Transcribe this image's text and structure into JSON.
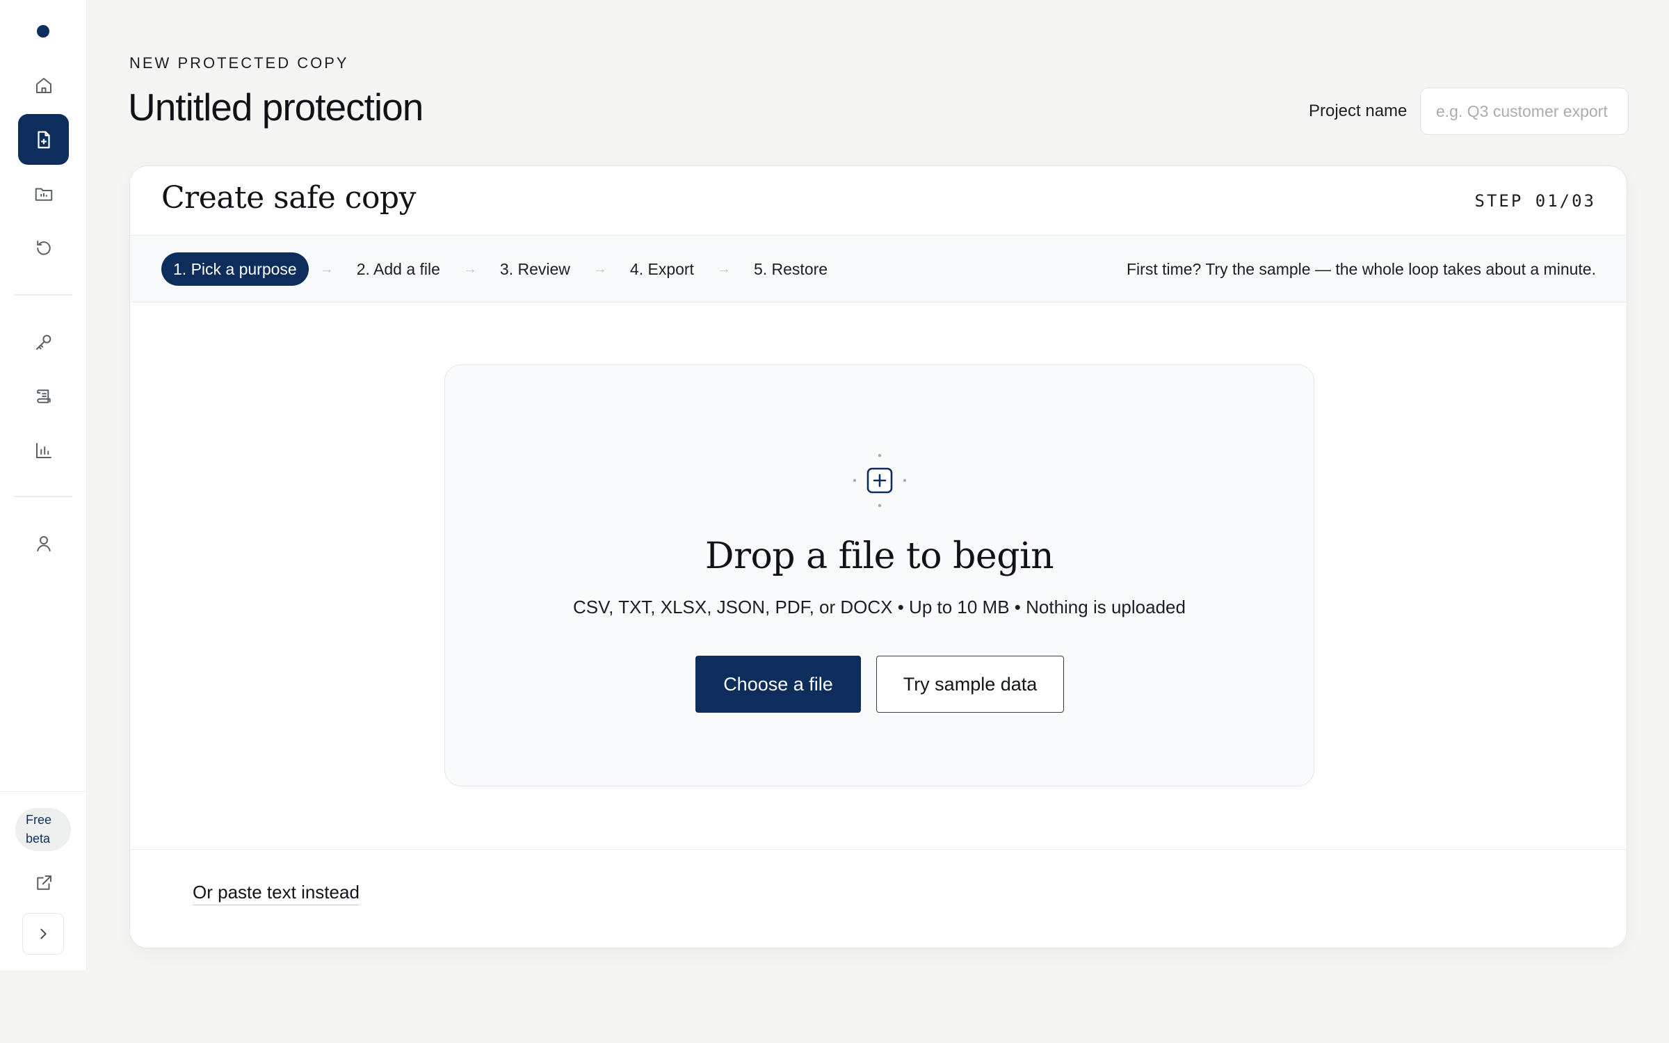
{
  "sidebar": {
    "nav": [
      {
        "name": "nav-home",
        "icon": "home-icon"
      },
      {
        "name": "nav-new-copy",
        "icon": "file-plus-icon",
        "active": true
      },
      {
        "name": "nav-projects",
        "icon": "folder-chart-icon"
      },
      {
        "name": "nav-history",
        "icon": "restore-icon"
      },
      {
        "name": "nav-keys",
        "icon": "key-icon"
      },
      {
        "name": "nav-logs",
        "icon": "scroll-icon"
      },
      {
        "name": "nav-analytics",
        "icon": "bar-chart-icon"
      },
      {
        "name": "nav-account",
        "icon": "user-icon"
      }
    ],
    "badge": "Free beta",
    "badge_line1": "Free",
    "badge_line2": "beta",
    "accent": "#0d2e5c"
  },
  "header": {
    "eyebrow": "NEW PROTECTED COPY",
    "title": "Untitled protection",
    "project_label": "Project name",
    "project_placeholder": "e.g. Q3 customer export",
    "project_value": ""
  },
  "card": {
    "title": "Create safe copy",
    "step_counter": "STEP 01/03",
    "steps": [
      {
        "label": "1. Pick a purpose",
        "active": true
      },
      {
        "label": "2. Add a file",
        "active": false
      },
      {
        "label": "3. Review",
        "active": false
      },
      {
        "label": "4. Export",
        "active": false
      },
      {
        "label": "5. Restore",
        "active": false
      }
    ],
    "hint": "First time? Try the sample — the whole loop takes about a minute."
  },
  "dropzone": {
    "icon": "upload-plus-icon",
    "heading": "Drop a file to begin",
    "subtext": "CSV, TXT, XLSX, JSON, PDF, or DOCX • Up to 10 MB • Nothing is uploaded",
    "primary_button": "Choose a file",
    "secondary_button": "Try sample data"
  },
  "footer": {
    "paste_link": "Or paste text instead"
  }
}
